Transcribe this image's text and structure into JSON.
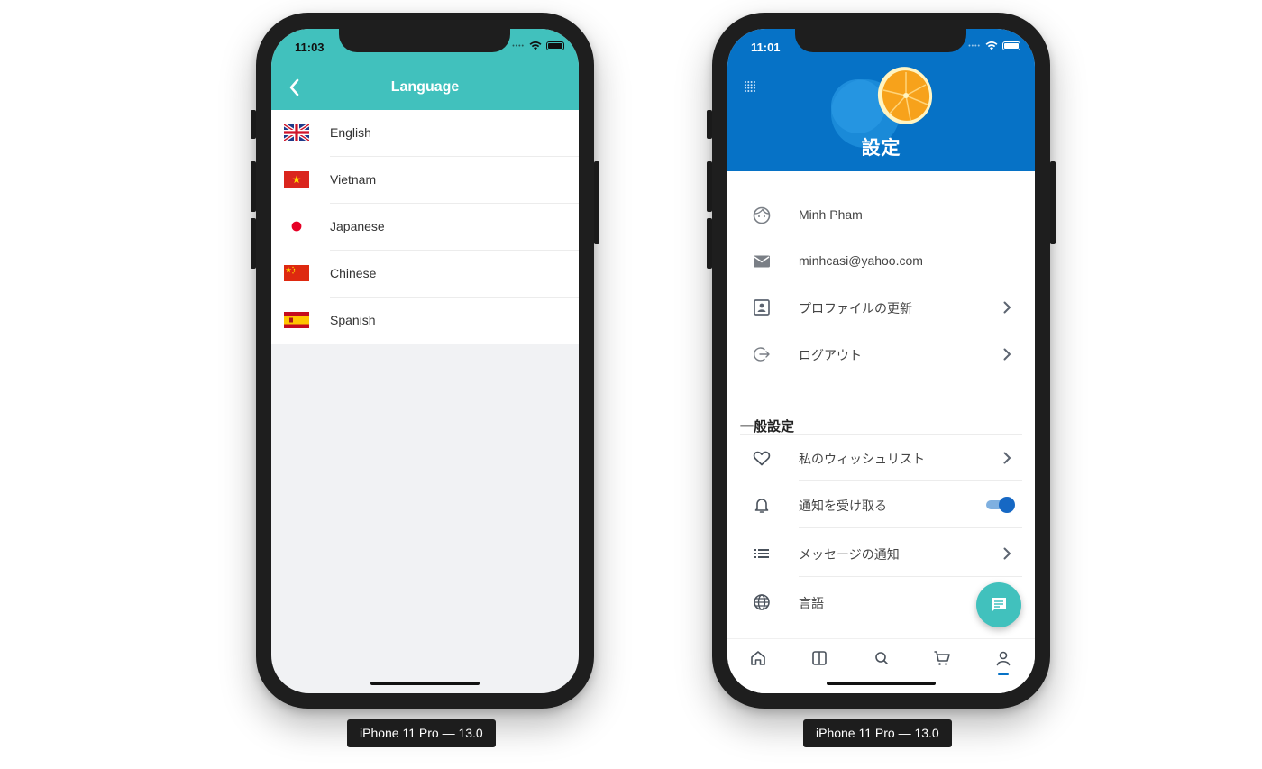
{
  "left_device": {
    "status_time": "11:03",
    "header_title": "Language",
    "languages": [
      {
        "label": "English",
        "flag": "uk-flag-icon"
      },
      {
        "label": "Vietnam",
        "flag": "vietnam-flag-icon"
      },
      {
        "label": "Japanese",
        "flag": "japan-flag-icon"
      },
      {
        "label": "Chinese",
        "flag": "china-flag-icon"
      },
      {
        "label": "Spanish",
        "flag": "spain-flag-icon"
      }
    ],
    "colors": {
      "header": "#41c1bd",
      "background": "#f1f2f4"
    }
  },
  "right_device": {
    "status_time": "11:01",
    "hero_title": "設定",
    "account": {
      "name": "Minh Pham",
      "email": "minhcasi@yahoo.com",
      "update_profile": "プロファイルの更新",
      "logout": "ログアウト"
    },
    "general_section_title": "一般設定",
    "general": {
      "wishlist": "私のウィッシュリスト",
      "notifications": "通知を受け取る",
      "notifications_enabled": true,
      "message_notifications": "メッセージの通知",
      "language": "言語"
    },
    "tabs": [
      "home-icon",
      "category-icon",
      "search-icon",
      "cart-icon",
      "profile-icon"
    ],
    "active_tab": "profile-icon",
    "colors": {
      "hero": "#0672c6",
      "accent": "#41c1bd",
      "toggle": "#1668c4"
    }
  },
  "captions": {
    "left": "iPhone 11 Pro — 13.0",
    "right": "iPhone 11 Pro — 13.0"
  }
}
